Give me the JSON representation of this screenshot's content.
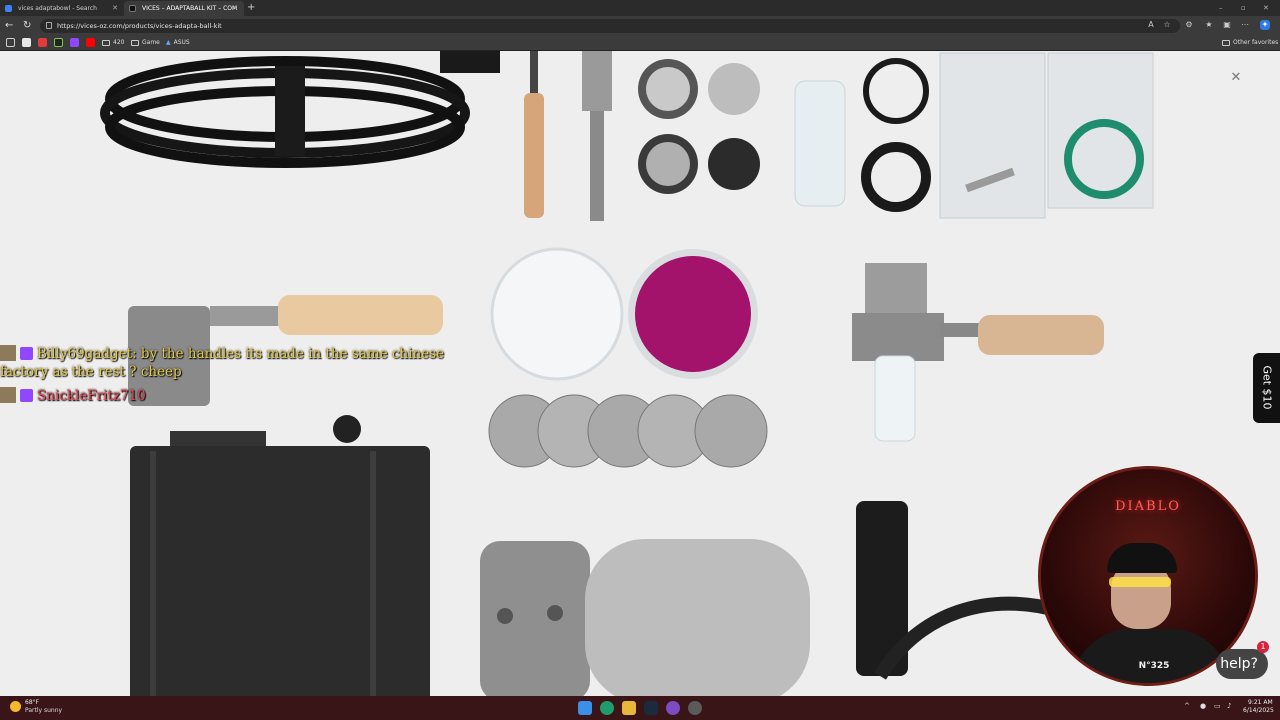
{
  "browser": {
    "tabs": [
      {
        "label": "vices adaptabowl - Search",
        "active": false
      },
      {
        "label": "VICES – ADAPTABALL KIT – COM",
        "active": true
      }
    ],
    "url": "https://vices-oz.com/products/vices-adapta-ball-kit",
    "bookmarks": [
      {
        "label": "420"
      },
      {
        "label": "Game"
      },
      {
        "label": "ASUS"
      }
    ],
    "other_favorites": "Other favorites"
  },
  "page": {
    "close_symbol": "✕",
    "promo_tab": "Get $10",
    "help_button": "help?",
    "help_badge": "1"
  },
  "chat": {
    "messages": [
      {
        "user": "Billy69gadget",
        "text_line1": "by the handles its made in the same chinese",
        "text_line2": "factory as the rest ? cheep"
      },
      {
        "user": "SnickleFritz710",
        "text_line1": "",
        "text_line2": ""
      }
    ]
  },
  "webcam": {
    "sign_text": "DIABLO",
    "jersey_text": "N°325"
  },
  "taskbar": {
    "weather_temp": "68°F",
    "weather_condition": "Partly sunny",
    "time": "9:21 AM",
    "date": "6/14/2025"
  },
  "colors": {
    "page_bg": "#eeeeef",
    "chrome_bg": "#3b3b3b",
    "taskbar_bg": "#3a1518",
    "chat_user": "#e2c94a",
    "chat_user2": "#e44a56",
    "twitch": "#9146ff"
  }
}
